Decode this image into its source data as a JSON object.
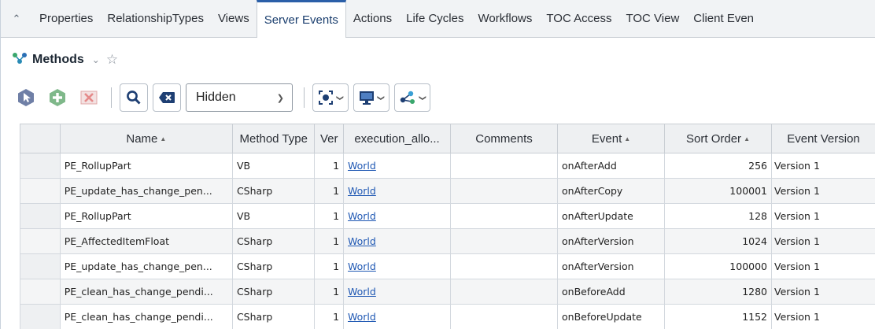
{
  "tabs": [
    {
      "label": "Properties",
      "active": false
    },
    {
      "label": "RelationshipTypes",
      "active": false
    },
    {
      "label": "Views",
      "active": false
    },
    {
      "label": "Server Events",
      "active": true
    },
    {
      "label": "Actions",
      "active": false
    },
    {
      "label": "Life Cycles",
      "active": false
    },
    {
      "label": "Workflows",
      "active": false
    },
    {
      "label": "TOC Access",
      "active": false
    },
    {
      "label": "TOC View",
      "active": false
    },
    {
      "label": "Client Even",
      "active": false
    }
  ],
  "methods": {
    "title": "Methods",
    "icon": "methods-network-icon"
  },
  "toolbar": {
    "select_value": "Hidden",
    "icons": [
      "pick-icon",
      "add-icon",
      "delete-icon",
      "search-icon",
      "clear-icon",
      "target-icon",
      "display-icon",
      "share-icon"
    ]
  },
  "colors": {
    "accent": "#2b5fa8",
    "link": "#1e57b3",
    "header_bg": "#eef0f2"
  },
  "grid": {
    "columns": [
      "Name",
      "Method Type",
      "Ver",
      "execution_allo...",
      "Comments",
      "Event",
      "Sort Order",
      "Event Version"
    ],
    "rows": [
      {
        "name": "PE_RollupPart",
        "type": "VB",
        "ver": "1",
        "exec": "World",
        "comments": "",
        "event": "onAfterAdd",
        "sort": "256",
        "eventver": "Version 1"
      },
      {
        "name": "PE_update_has_change_pen...",
        "type": "CSharp",
        "ver": "1",
        "exec": "World",
        "comments": "",
        "event": "onAfterCopy",
        "sort": "100001",
        "eventver": "Version 1"
      },
      {
        "name": "PE_RollupPart",
        "type": "VB",
        "ver": "1",
        "exec": "World",
        "comments": "",
        "event": "onAfterUpdate",
        "sort": "128",
        "eventver": "Version 1"
      },
      {
        "name": "PE_AffectedItemFloat",
        "type": "CSharp",
        "ver": "1",
        "exec": "World",
        "comments": "",
        "event": "onAfterVersion",
        "sort": "1024",
        "eventver": "Version 1"
      },
      {
        "name": "PE_update_has_change_pen...",
        "type": "CSharp",
        "ver": "1",
        "exec": "World",
        "comments": "",
        "event": "onAfterVersion",
        "sort": "100000",
        "eventver": "Version 1"
      },
      {
        "name": "PE_clean_has_change_pendi...",
        "type": "CSharp",
        "ver": "1",
        "exec": "World",
        "comments": "",
        "event": "onBeforeAdd",
        "sort": "1280",
        "eventver": "Version 1"
      },
      {
        "name": "PE_clean_has_change_pendi...",
        "type": "CSharp",
        "ver": "1",
        "exec": "World",
        "comments": "",
        "event": "onBeforeUpdate",
        "sort": "1152",
        "eventver": "Version 1"
      }
    ]
  }
}
